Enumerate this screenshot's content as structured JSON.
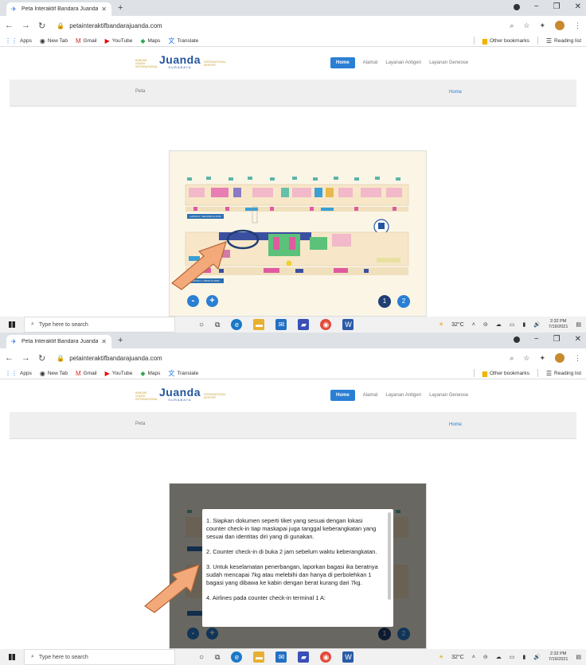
{
  "browser": {
    "tab_title": "Peta Interaktif Bandara Juanda",
    "url": "petainteraktifbandarajuanda.com",
    "bookmarks": [
      "Apps",
      "New Tab",
      "Gmail",
      "YouTube",
      "Maps",
      "Translate"
    ],
    "bookmarks_right": [
      "Other bookmarks",
      "Reading list"
    ]
  },
  "site": {
    "logo_word": "Juanda",
    "logo_sub": "SURABAYA",
    "logo_left": "BANDAR UDARA INTERNASIONAL",
    "logo_right": "INTERNATIONAL AIRPORT",
    "nav": [
      "Home",
      "Alamat",
      "Layanan Antigen",
      "Layanan Geneose"
    ],
    "page_title": "Peta",
    "breadcrumb": "Home"
  },
  "map": {
    "zoom_out": "-",
    "zoom_in": "+",
    "pages": [
      "1",
      "2"
    ],
    "floor_top": "LANTAI 2 / SECOND FLOOR",
    "floor_bottom": "LANTAI 1 / FIRST FLOOR"
  },
  "popup": {
    "paragraphs": [
      "1. Siapkan dokumen seperti tiket yang sesuai dengan lokasi counter check-in tiap maskapai juga tanggal keberangkatan yang sesuai dan identitas diri yang di gunakan.",
      "2. Counter check-in di buka 2 jam sebelum waktu keberangkatan.",
      "3. Untuk keselamatan penerbangan, laporkan bagasi ika beratnya sudah mencapai 7kg atau melebihi dan hanya di perbolehkan 1 bagasi yang dibawa ke kabin dengan berat kurang dari 7kg.",
      "4. Airlines pada counter check-in terminal 1 A:"
    ]
  },
  "taskbar": {
    "search_placeholder": "Type here to search",
    "weather": "32°C",
    "time": "2:32 PM",
    "date": "7/19/2021"
  },
  "colors": {
    "accent": "#2a7fd4",
    "arrow": "#f4a97a",
    "map_bg": "#fbf5e6"
  }
}
